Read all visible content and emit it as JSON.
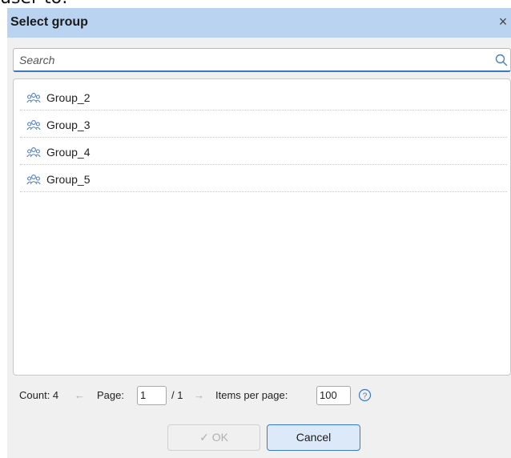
{
  "background": {
    "partial_text": "user to:"
  },
  "dialog": {
    "title": "Select group",
    "close_glyph": "×",
    "search": {
      "placeholder": "Search",
      "value": ""
    },
    "groups": [
      {
        "label": "Group_2",
        "icon": "group-icon"
      },
      {
        "label": "Group_3",
        "icon": "group-icon"
      },
      {
        "label": "Group_4",
        "icon": "group-icon"
      },
      {
        "label": "Group_5",
        "icon": "group-icon"
      }
    ],
    "footer": {
      "count_label": "Count: 4",
      "prev_arrow": "←",
      "page_label": "Page:",
      "page_value": "1",
      "total_pages": "/ 1",
      "next_arrow": "→",
      "items_per_page_label": "Items per page:",
      "items_per_page_value": "100"
    },
    "buttons": {
      "ok_check": "✓",
      "ok_label": "OK",
      "cancel_label": "Cancel"
    }
  },
  "colors": {
    "titlebar": "#b9d3f0",
    "accent": "#3b79c8",
    "icon": "#4a7fc1"
  }
}
